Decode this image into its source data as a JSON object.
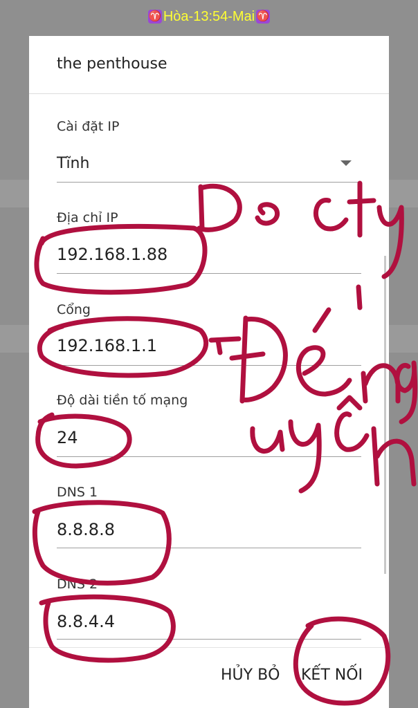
{
  "status_bar": {
    "zodiac_left": "♈",
    "text": "Hòa-13:54-Mai",
    "zodiac_right": "♈"
  },
  "dialog": {
    "title": "the penthouse",
    "ip_settings": {
      "label": "Cài đặt IP",
      "value": "Tĩnh"
    },
    "ip_address": {
      "label": "Địa chỉ IP",
      "value": "192.168.1.88"
    },
    "gateway": {
      "label": "Cổng",
      "value": "192.168.1.1"
    },
    "prefix_length": {
      "label": "Độ dài tiền tố mạng",
      "value": "24"
    },
    "dns1": {
      "label": "DNS 1",
      "value": "8.8.8.8"
    },
    "dns2": {
      "label": "DNS 2",
      "value": "8.8.4.4"
    },
    "cancel_label": "HỦY BỎ",
    "connect_label": "KẾT NỐI"
  },
  "colors": {
    "ink": "#b0103f",
    "status_text": "#ffff33",
    "overlay": "#8f8f8f"
  }
}
